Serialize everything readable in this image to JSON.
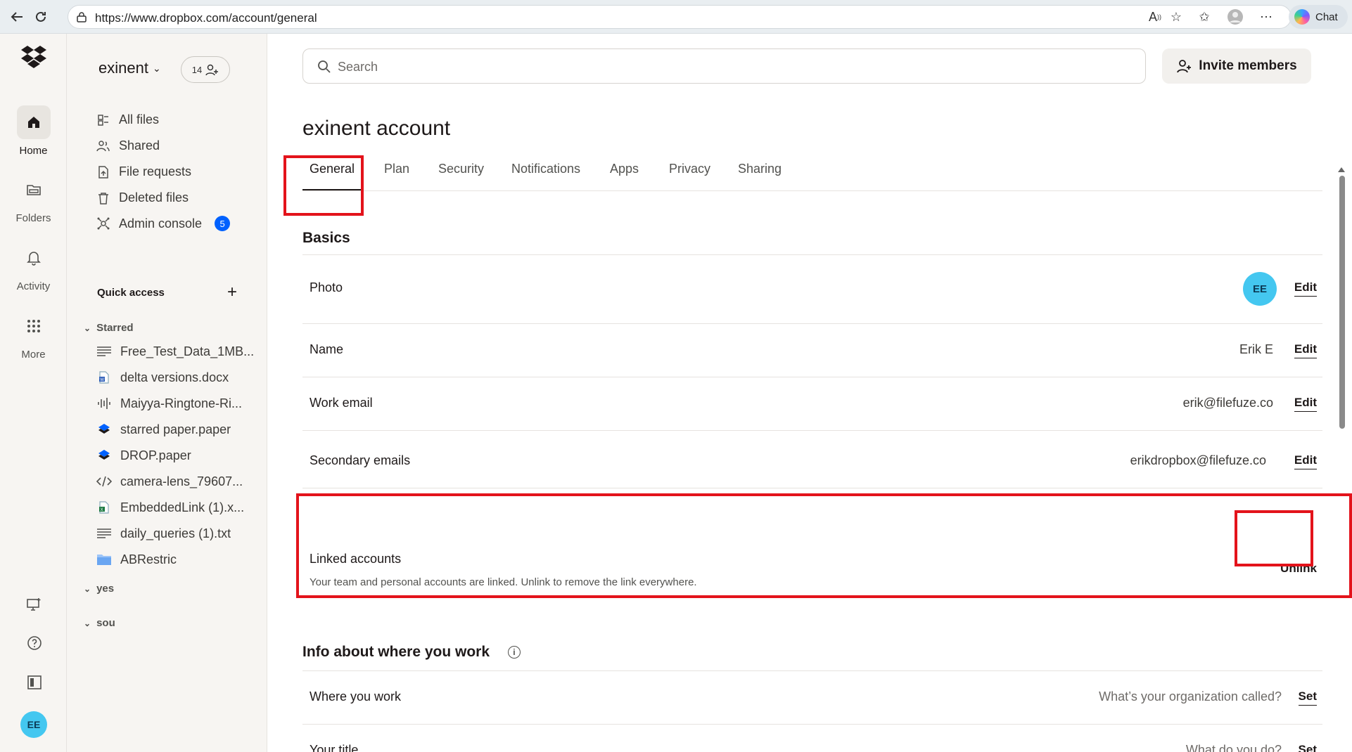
{
  "browser": {
    "url": "https://www.dropbox.com/account/general",
    "chat_label": "Chat"
  },
  "rail": {
    "items": [
      {
        "label": "Home",
        "icon": "home-icon"
      },
      {
        "label": "Folders",
        "icon": "folder-icon"
      },
      {
        "label": "Activity",
        "icon": "bell-icon"
      },
      {
        "label": "More",
        "icon": "grid-icon"
      }
    ],
    "avatar_initials": "EE"
  },
  "sidebar": {
    "team_name": "exinent",
    "members_count": "14",
    "nav": [
      {
        "label": "All files",
        "icon": "files-icon"
      },
      {
        "label": "Shared",
        "icon": "shared-icon"
      },
      {
        "label": "File requests",
        "icon": "file-request-icon"
      },
      {
        "label": "Deleted files",
        "icon": "trash-icon"
      },
      {
        "label": "Admin console",
        "icon": "admin-icon",
        "badge": "5"
      }
    ],
    "quick_access_title": "Quick access",
    "starred_title": "Starred",
    "starred": [
      {
        "label": "Free_Test_Data_1MB...",
        "icon": "text-file-icon"
      },
      {
        "label": "delta versions.docx",
        "icon": "word-file-icon"
      },
      {
        "label": "Maiyya-Ringtone-Ri...",
        "icon": "audio-file-icon"
      },
      {
        "label": "starred paper.paper",
        "icon": "paper-file-icon"
      },
      {
        "label": "DROP.paper",
        "icon": "paper-file-icon"
      },
      {
        "label": "camera-lens_79607...",
        "icon": "code-file-icon"
      },
      {
        "label": "EmbeddedLink (1).x...",
        "icon": "excel-file-icon"
      },
      {
        "label": "daily_queries (1).txt",
        "icon": "text-file-icon"
      },
      {
        "label": "ABRestric",
        "icon": "folder-icon"
      }
    ],
    "groups": [
      "yes",
      "sou"
    ]
  },
  "main": {
    "search_placeholder": "Search",
    "invite_label": "Invite members",
    "page_title": "exinent account",
    "tabs": [
      "General",
      "Plan",
      "Security",
      "Notifications",
      "Apps",
      "Privacy",
      "Sharing"
    ],
    "basics_title": "Basics",
    "rows": {
      "photo": {
        "label": "Photo",
        "initials": "EE",
        "action": "Edit"
      },
      "name": {
        "label": "Name",
        "value": "Erik E",
        "action": "Edit"
      },
      "work_email": {
        "label": "Work email",
        "value": "erik@filefuze.co",
        "action": "Edit"
      },
      "secondary_emails": {
        "label": "Secondary emails",
        "value": "erikdropbox@filefuze.co",
        "action": "Edit"
      },
      "linked_accounts": {
        "label": "Linked accounts",
        "description": "Your team and personal accounts are linked. Unlink to remove the link everywhere.",
        "action": "Unlink"
      }
    },
    "work_section_title": "Info about where you work",
    "work_rows": {
      "where": {
        "label": "Where you work",
        "placeholder": "What’s your organization called?",
        "action": "Set"
      },
      "title": {
        "label": "Your title",
        "placeholder": "What do you do?",
        "action": "Set"
      }
    }
  },
  "colors": {
    "accent": "#0061fe",
    "highlight": "#e3131b",
    "avatar": "#44c7f0"
  }
}
